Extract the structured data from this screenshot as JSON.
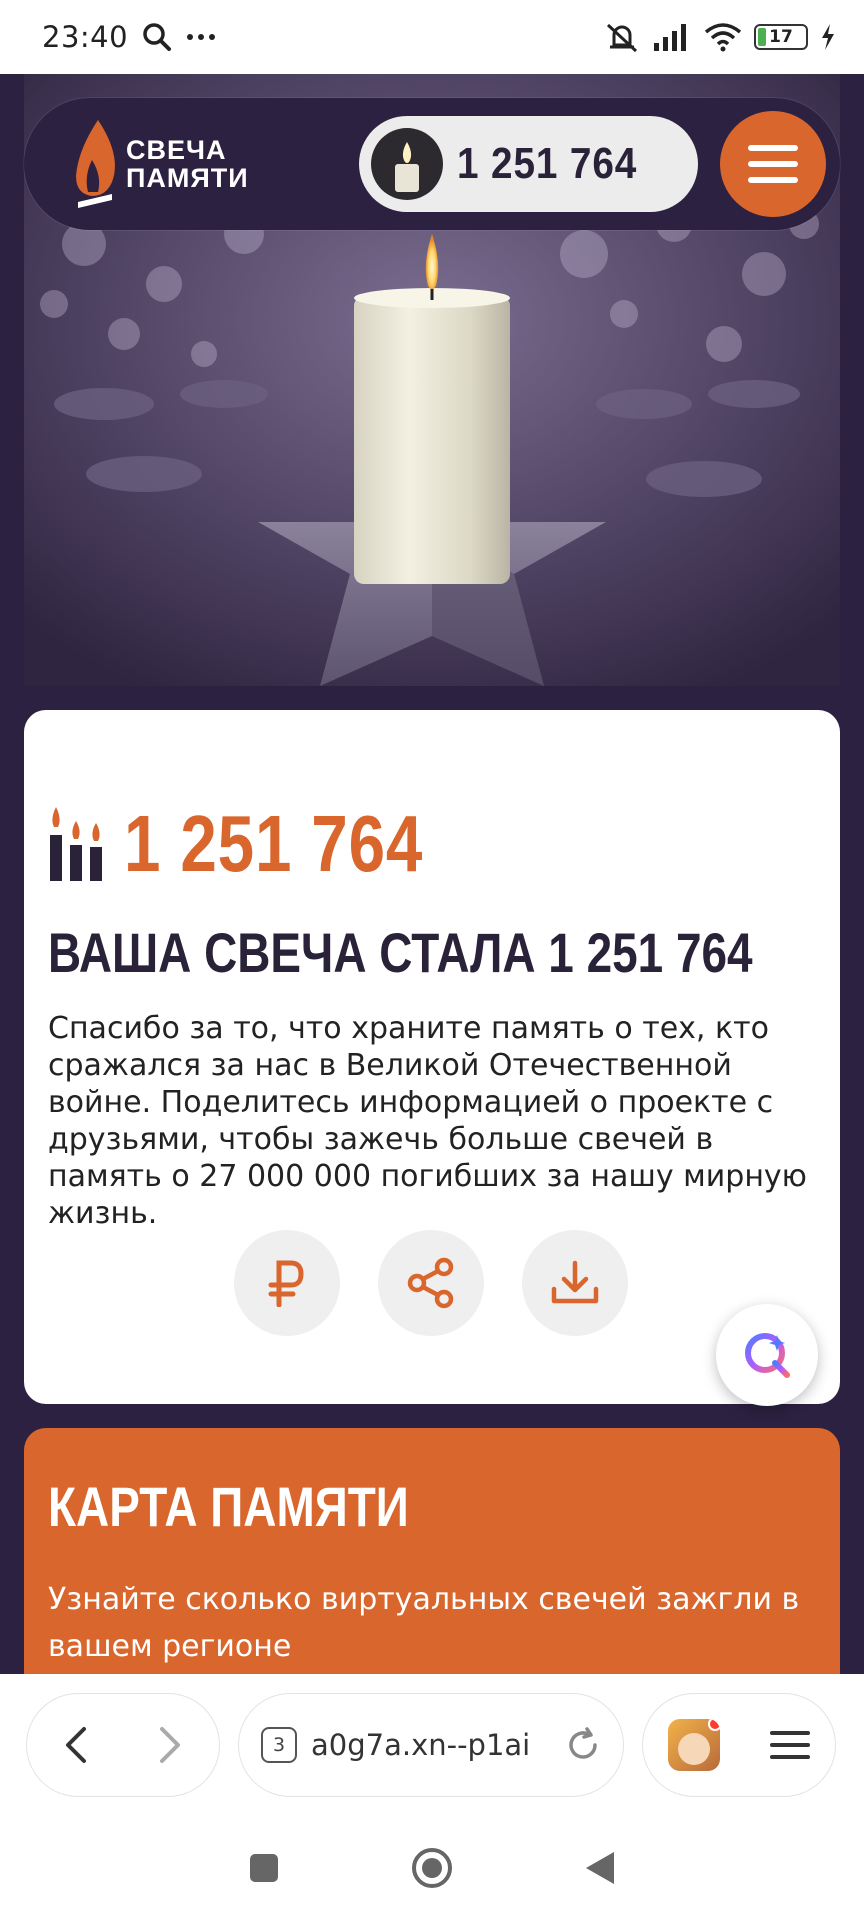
{
  "status": {
    "time": "23:40",
    "battery": "17"
  },
  "header": {
    "logo_line1": "СВЕЧА",
    "logo_line2": "ПАМЯТИ",
    "counter": "1 251 764"
  },
  "card": {
    "count": "1 251 764",
    "headline": "ВАША СВЕЧА СТАЛА 1 251 764",
    "text": "Спасибо за то, что храните память о тех, кто сражался за нас в Великой Отечественной войне. Поделитесь информацией о проекте с друзьями, чтобы зажечь больше свечей в память о 27 000 000 погибших за нашу мирную жизнь."
  },
  "map": {
    "title": "КАРТА ПАМЯТИ",
    "subtitle": "Узнайте сколько виртуальных свечей зажгли в вашем регионе"
  },
  "browser": {
    "url": "a0g7a.xn--p1ai",
    "tabs": "3"
  },
  "colors": {
    "accent": "#d9662c",
    "dark": "#2c2140"
  },
  "icons": [
    "search-icon",
    "more-icon",
    "mute-icon",
    "signal-icon",
    "wifi-icon",
    "battery-icon",
    "charging-icon",
    "menu-icon",
    "ruble-icon",
    "share-icon",
    "download-icon",
    "ai-assistant-icon",
    "back-icon",
    "forward-icon",
    "reload-icon",
    "browser-menu-icon"
  ]
}
